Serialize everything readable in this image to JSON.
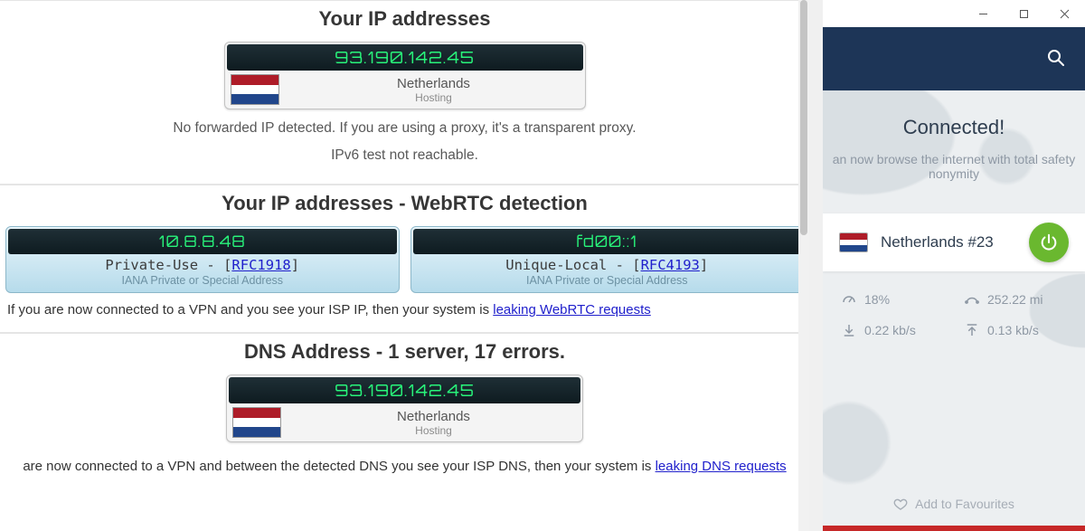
{
  "leak": {
    "section1": {
      "title": "Your IP addresses",
      "ip": "93.190.142.45",
      "country": "Netherlands",
      "host_type": "Hosting",
      "note1": "No forwarded IP detected. If you are using a proxy, it's a transparent proxy.",
      "note2": "IPv6 test not reachable."
    },
    "section2": {
      "title": "Your IP addresses - WebRTC detection",
      "cards": [
        {
          "ip": "10.8.8.48",
          "line1a": "Private-Use - [",
          "rfc": "RFC1918",
          "line1b": "]",
          "line2": "IANA Private or Special Address"
        },
        {
          "ip": "fd00::1",
          "line1a": "Unique-Local - [",
          "rfc": "RFC4193",
          "line1b": "]",
          "line2": "IANA Private or Special Address"
        }
      ],
      "para_a": "If you are now connected to a VPN and you see your ISP IP, then your system is ",
      "para_link": "leaking WebRTC requests"
    },
    "section3": {
      "title": "DNS Address - 1 server, 17 errors.",
      "ip": "93.190.142.45",
      "country": "Netherlands",
      "host_type": "Hosting",
      "para_a": "are now connected to a VPN and between the detected DNS you see your ISP DNS, then your system is ",
      "para_link": "leaking DNS requests"
    }
  },
  "vpn": {
    "status_title": "Connected!",
    "status_desc_a": "an now browse the internet with total safety",
    "status_desc_b": "nonymity",
    "server_name": "Netherlands #23",
    "stats": {
      "load": "18%",
      "distance": "252.22 mi",
      "down": "0.22 kb/s",
      "up": "0.13 kb/s"
    },
    "favourites": "Add to Favourites"
  }
}
